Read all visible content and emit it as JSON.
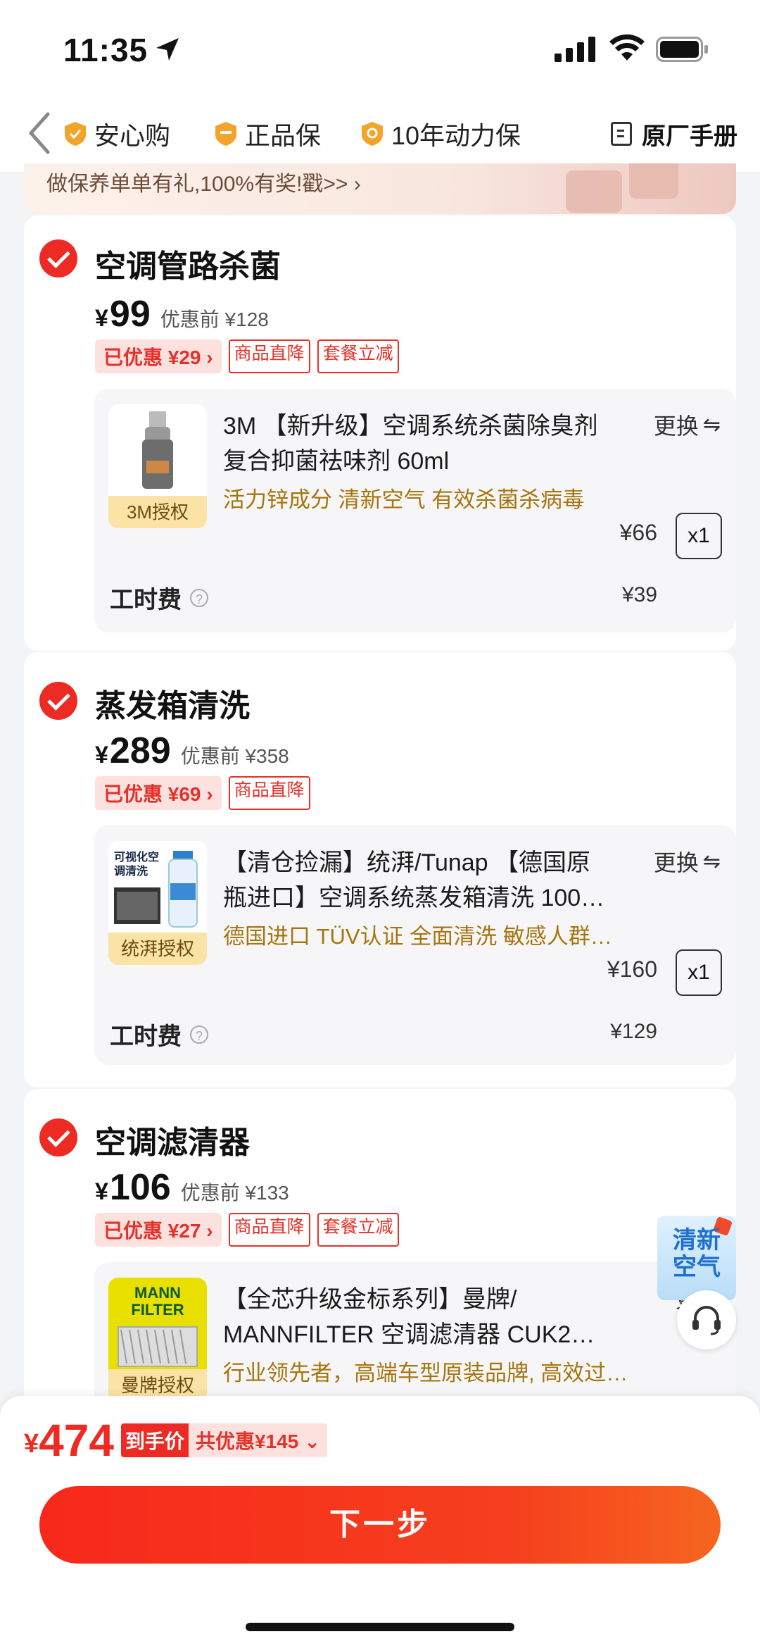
{
  "status": {
    "time": "11:35"
  },
  "nav": {
    "badges": [
      "安心购",
      "正品保",
      "10年动力保"
    ],
    "manual": "原厂手册"
  },
  "promo": {
    "text": "做保养单单有礼,100%有奖!戳>>  ›"
  },
  "services": [
    {
      "title": "空调管路杀菌",
      "currency": "¥",
      "price": "99",
      "before": "优惠前 ¥128",
      "discount": "已优惠 ¥29 ›",
      "tags": [
        "商品直降",
        "套餐立减"
      ],
      "product": {
        "name_line1": "3M 【新升级】空调系统杀菌除臭剂",
        "name_line2": "复合抑菌祛味剂 60ml",
        "desc": "活力锌成分 清新空气 有效杀菌杀病毒",
        "thumb_label": "3M授权",
        "swap": "更换",
        "price": "¥66",
        "qty": "x1"
      },
      "labor": {
        "label": "工时费",
        "price": "¥39"
      }
    },
    {
      "title": "蒸发箱清洗",
      "currency": "¥",
      "price": "289",
      "before": "优惠前 ¥358",
      "discount": "已优惠 ¥69 ›",
      "tags": [
        "商品直降"
      ],
      "product": {
        "name_line1": "【清仓捡漏】统湃/Tunap 【德国原",
        "name_line2": "瓶进口】空调系统蒸发箱清洗 100…",
        "desc": "德国进口 TÜV认证 全面清洗 敏感人群…",
        "thumb_label": "统湃授权",
        "thumb_text": "可视化空调清洗",
        "swap": "更换",
        "price": "¥160",
        "qty": "x1"
      },
      "labor": {
        "label": "工时费",
        "price": "¥129"
      }
    },
    {
      "title": "空调滤清器",
      "currency": "¥",
      "price": "106",
      "before": "优惠前 ¥133",
      "discount": "已优惠 ¥27 ›",
      "tags": [
        "商品直降",
        "套餐立减"
      ],
      "product": {
        "name_line1": "【全芯升级金标系列】曼牌/",
        "name_line2": "MANNFILTER 空调滤清器 CUK2…",
        "desc": "行业领先者，高端车型原装品牌, 高效过…",
        "thumb_label": "曼牌授权",
        "thumb_text": "MANN FILTER",
        "swap": "更换"
      }
    }
  ],
  "float_ad": {
    "text": "清新空气"
  },
  "bottom": {
    "currency": "¥",
    "total": "474",
    "final_label": "到手价",
    "saving": "共优惠¥145",
    "next_button": "下一步"
  },
  "colors": {
    "accent": "#ee2a24",
    "gold_text": "#a6750c"
  }
}
